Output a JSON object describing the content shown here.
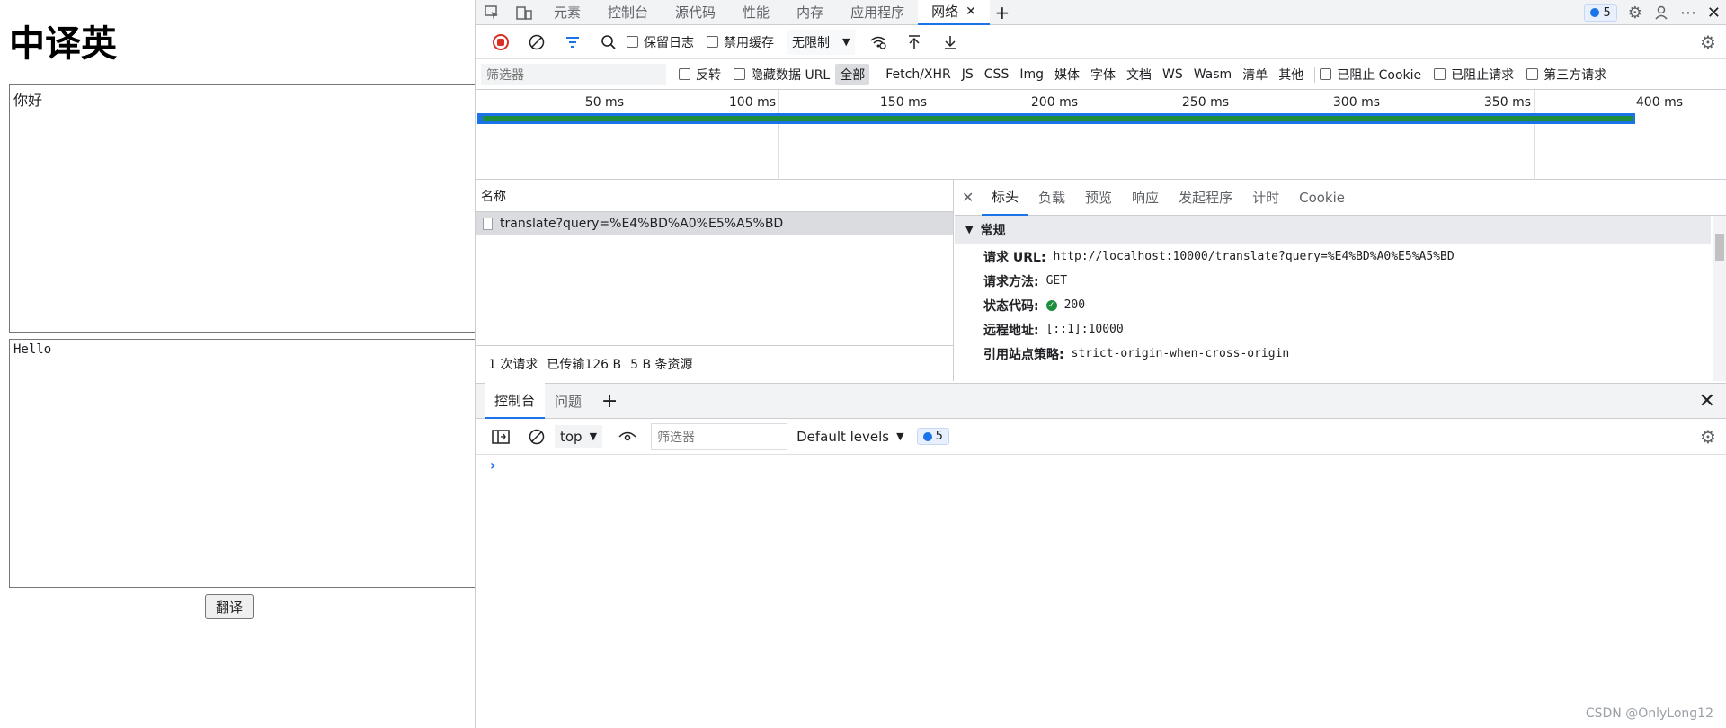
{
  "page": {
    "title": "中译英",
    "source_text": "你好",
    "result_text": "Hello",
    "translate_button": "翻译"
  },
  "devtools": {
    "top_tabs": [
      "元素",
      "控制台",
      "源代码",
      "性能",
      "内存",
      "应用程序",
      "网络"
    ],
    "active_tab_close": "✕",
    "add_tab": "+",
    "issues_count": "5",
    "network_toolbar": {
      "preserve_log": "保留日志",
      "disable_cache": "禁用缓存",
      "throttling": "无限制"
    },
    "filter_bar": {
      "placeholder": "筛选器",
      "invert": "反转",
      "hide_data_urls": "隐藏数据 URL",
      "types": [
        "全部",
        "Fetch/XHR",
        "JS",
        "CSS",
        "Img",
        "媒体",
        "字体",
        "文档",
        "WS",
        "Wasm",
        "清单",
        "其他"
      ],
      "blocked_cookies": "已阻止 Cookie",
      "blocked_requests": "已阻止请求",
      "third_party": "第三方请求"
    },
    "timeline": {
      "ticks": [
        "50 ms",
        "100 ms",
        "150 ms",
        "200 ms",
        "250 ms",
        "300 ms",
        "350 ms",
        "400 ms"
      ]
    },
    "request_list": {
      "header": "名称",
      "rows": [
        "translate?query=%E4%BD%A0%E5%A5%BD"
      ],
      "status": {
        "requests": "1 次请求",
        "transferred": "已传输126 B",
        "resources": "5 B 条资源"
      }
    },
    "details": {
      "tabs": [
        "标头",
        "负载",
        "预览",
        "响应",
        "发起程序",
        "计时",
        "Cookie"
      ],
      "section": "常规",
      "fields": {
        "url_key": "请求 URL:",
        "url_val": "http://localhost:10000/translate?query=%E4%BD%A0%E5%A5%BD",
        "method_key": "请求方法:",
        "method_val": "GET",
        "status_key": "状态代码:",
        "status_val": "200",
        "remote_key": "远程地址:",
        "remote_val": "[::1]:10000",
        "referrer_key": "引用站点策略:",
        "referrer_val": "strict-origin-when-cross-origin"
      }
    },
    "console": {
      "tabs": [
        "控制台",
        "问题"
      ],
      "context": "top",
      "filter_placeholder": "筛选器",
      "levels": "Default levels",
      "issues_count": "5",
      "prompt": "›"
    }
  },
  "watermark": "CSDN @OnlyLong12"
}
